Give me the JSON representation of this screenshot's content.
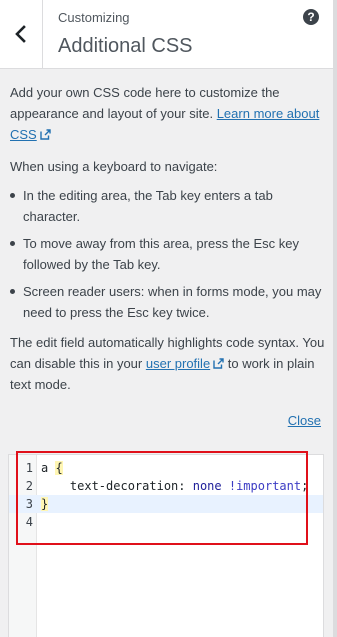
{
  "header": {
    "subtitle": "Customizing",
    "title": "Additional CSS",
    "help_glyph": "?"
  },
  "description": {
    "intro": "Add your own CSS code here to customize the appearance and layout of your site. ",
    "learn_more_link": "Learn more about CSS",
    "keyboard_heading": "When using a keyboard to navigate:",
    "tips": [
      "In the editing area, the Tab key enters a tab character.",
      "To move away from this area, press the Esc key followed by the Tab key.",
      "Screen reader users: when in forms mode, you may need to press the Esc key twice."
    ],
    "syntax_before": "The edit field automatically highlights code syntax. You can disable this in your ",
    "user_profile_link": "user profile",
    "syntax_after": " to work in plain text mode.",
    "close_link": "Close"
  },
  "editor": {
    "line_numbers": [
      "1",
      "2",
      "3",
      "4"
    ],
    "line1_selector": "a ",
    "line1_brace": "{",
    "line2_property": "    text-decoration: ",
    "line2_value": "none",
    "line2_important": " !important",
    "line2_semicolon": ";",
    "line3_brace": "}",
    "active_line": 3
  },
  "colors": {
    "link": "#2271b1",
    "highlight_box": "#e0101a",
    "active_line_bg": "#e8f2ff"
  },
  "icons": {
    "back": "chevron-left-icon",
    "help": "help-icon",
    "external": "external-link-icon"
  }
}
